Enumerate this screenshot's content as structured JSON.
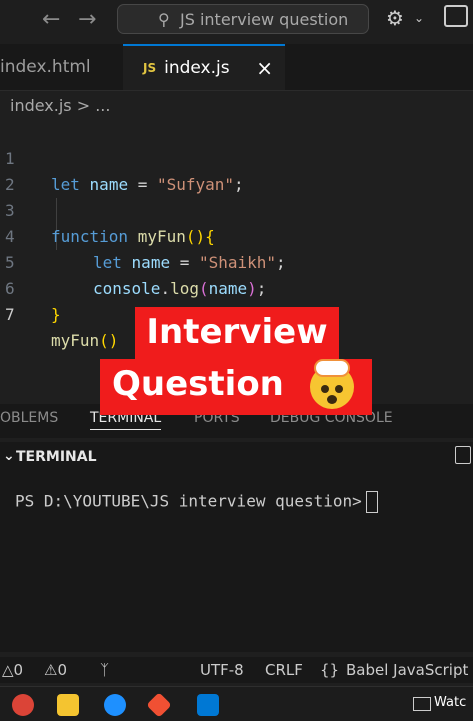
{
  "titlebar": {
    "back_icon": "arrow-left",
    "forward_icon": "arrow-right",
    "search_text": "JS interview question",
    "copilot_icon": "copilot-icon",
    "layout_icon": "layout-icon"
  },
  "tabs": [
    {
      "label": "index.html"
    },
    {
      "badge": "JS",
      "label": "index.js",
      "close": "×"
    }
  ],
  "breadcrumb": "index.js > ...",
  "editor": {
    "line_numbers": [
      "1",
      "2",
      "3",
      "4",
      "5",
      "6",
      "7"
    ],
    "code": {
      "l1_kw": "let",
      "l1_var": "name",
      "l1_op": " = ",
      "l1_str": "\"Sufyan\"",
      "l1_end": ";",
      "l3_kw": "function",
      "l3_fn": "myFun",
      "l3_paren": "()",
      "l3_brace": "{",
      "l4_kw": "let",
      "l4_var": "name",
      "l4_op": " = ",
      "l4_str": "\"Shaikh\"",
      "l4_end": ";",
      "l5_obj": "console",
      "l5_dot": ".",
      "l5_fn": "log",
      "l5_open": "(",
      "l5_arg": "name",
      "l5_close": ")",
      "l5_end": ";",
      "l6_brace": "}",
      "l7_fn": "myFun",
      "l7_paren": "()"
    }
  },
  "overlay": {
    "line1": "Interview",
    "line2": "Question"
  },
  "panel_tabs": [
    "OBLEMS",
    "TERMINAL",
    "PORTS",
    "DEBUG CONSOLE"
  ],
  "terminal": {
    "header": "TERMINAL",
    "prompt": "PS D:\\YOUTUBE\\JS interview question>"
  },
  "statusbar": {
    "errors": "0",
    "warnings": "0",
    "encoding": "UTF-8",
    "eol": "CRLF",
    "braces": "{}",
    "language": "Babel JavaScript"
  },
  "taskbar": {
    "label": "Watc"
  },
  "colors": {
    "keyword": "#569cd6",
    "variable": "#9cdcfe",
    "string": "#ce9178",
    "function": "#dcdcaa",
    "overlay_bg": "#f01c1c",
    "tab_accent": "#0078d4"
  }
}
